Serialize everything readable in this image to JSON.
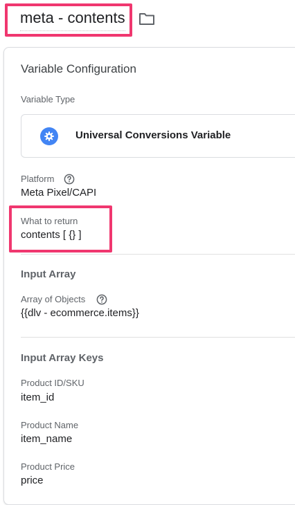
{
  "header": {
    "title": "meta - contents",
    "folder_icon": "folder-icon"
  },
  "config": {
    "card_title": "Variable Configuration",
    "variable_type_label": "Variable Type",
    "variable_type_value": "Universal Conversions Variable",
    "variable_type_icon": "gear-icon",
    "platform_label": "Platform",
    "platform_value": "Meta Pixel/CAPI",
    "return_label": "What to return",
    "return_value": "contents [ {} ]"
  },
  "input_array": {
    "section_title": "Input Array",
    "array_label": "Array of Objects",
    "array_value": "{{dlv - ecommerce.items}}"
  },
  "input_keys": {
    "section_title": "Input Array Keys",
    "fields": [
      {
        "label": "Product ID/SKU",
        "value": "item_id"
      },
      {
        "label": "Product Name",
        "value": "item_name"
      },
      {
        "label": "Product Price",
        "value": "price"
      }
    ]
  },
  "colors": {
    "highlight": "#f0376f",
    "icon_blue": "#4285f4"
  }
}
